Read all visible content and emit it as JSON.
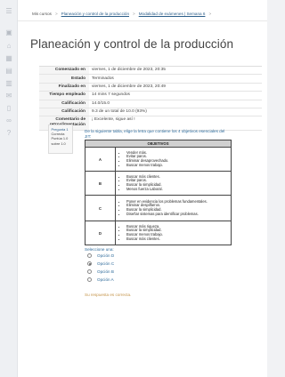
{
  "sidebar": {
    "icons": [
      "menu-icon",
      "dashboard-icon",
      "home-icon",
      "calendar-icon",
      "files-icon",
      "grades-icon",
      "messages-icon",
      "mobile-icon",
      "link-icon",
      "help-icon"
    ]
  },
  "breadcrumb": {
    "items": [
      "Mis cursos",
      "Planeación y control de la producción",
      "Modalidad de exámenes | Semana 6"
    ]
  },
  "page": {
    "title": "Planeación y control de la producción"
  },
  "summary": {
    "rows": [
      {
        "key": "Comenzado en",
        "value": "viernes, 1 de diciembre de 2023, 20:35"
      },
      {
        "key": "Estado",
        "value": "Terminados"
      },
      {
        "key": "Finalizado en",
        "value": "viernes, 1 de diciembre de 2023, 20:49"
      },
      {
        "key": "Tiempo empleado",
        "value": "14 mins 7 segundos"
      },
      {
        "key": "Calificación",
        "value": "14.0/15.0"
      },
      {
        "key": "Calificación",
        "value": "9.3 de un total de 10.0 (93%)"
      },
      {
        "key": "Comentario de retroalimentación",
        "value": "¡ Excelente, sigue así !"
      }
    ]
  },
  "question": {
    "info": [
      "Pregunta 1",
      "Correcta",
      "Puntúa 1.0",
      "sobre 1.0"
    ],
    "text": "De la siguiente tabla, elige la letra que contiene los 4 objetivos esenciales del JIT:",
    "table": {
      "header": "OBJETIVOS",
      "rows": [
        {
          "letter": "A",
          "items": [
            "Vender más.",
            "Evitar paros.",
            "Eliminar desaprovechado.",
            "Buscar menos trabajo."
          ]
        },
        {
          "letter": "B",
          "items": [
            "Buscar más clientes.",
            "Evitar paros.",
            "Buscar la simplicidad.",
            "Menos fuerza Laboral."
          ]
        },
        {
          "letter": "C",
          "items": [
            "Poner en evidencia los problemas fundamentales.",
            "Eliminar despilfarros.",
            "Buscar la simplicidad.",
            "Diseñar sistemas para identificar problemas."
          ]
        },
        {
          "letter": "D",
          "items": [
            "Buscar más riqueza.",
            "Buscar la simplicidad.",
            "Buscar menos trabajo.",
            "Buscar más clientes."
          ]
        }
      ]
    },
    "select_label": "Seleccione una:",
    "options": [
      {
        "label": "Opción D",
        "selected": false
      },
      {
        "label": "Opción C",
        "selected": true
      },
      {
        "label": "Opción B",
        "selected": false
      },
      {
        "label": "Opción A",
        "selected": false
      }
    ],
    "feedback": "Su respuesta es correcta."
  }
}
